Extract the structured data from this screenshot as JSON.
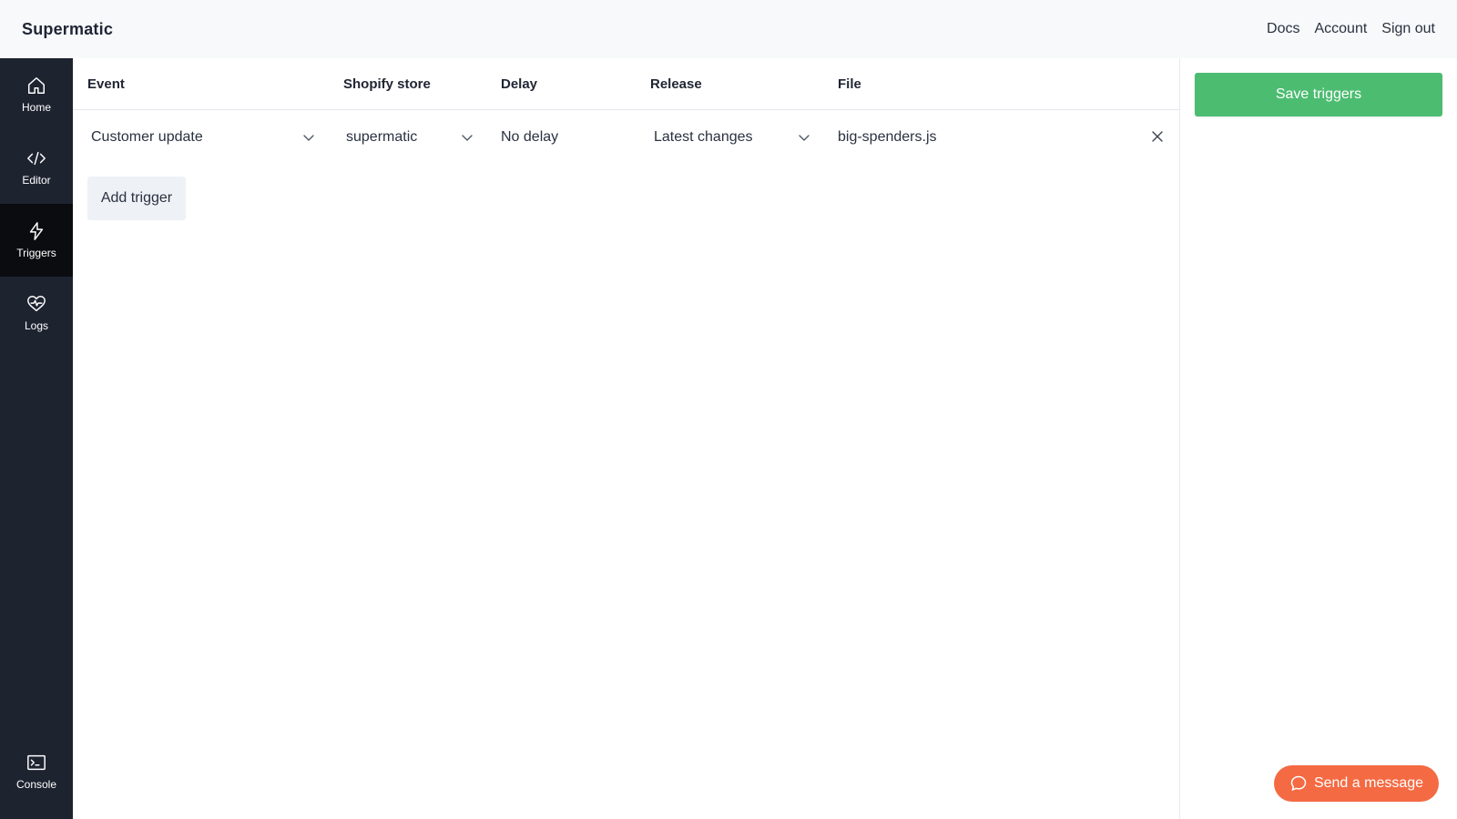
{
  "app": {
    "brand": "Supermatic"
  },
  "topnav": {
    "docs": "Docs",
    "account": "Account",
    "signout": "Sign out"
  },
  "sidebar": {
    "items": [
      {
        "label": "Home",
        "icon": "home-icon"
      },
      {
        "label": "Editor",
        "icon": "code-icon"
      },
      {
        "label": "Triggers",
        "icon": "lightning-icon",
        "active": true
      },
      {
        "label": "Logs",
        "icon": "heart-pulse-icon"
      }
    ],
    "console": {
      "label": "Console",
      "icon": "terminal-icon"
    }
  },
  "table": {
    "headers": {
      "event": "Event",
      "store": "Shopify store",
      "delay": "Delay",
      "release": "Release",
      "file": "File"
    },
    "rows": [
      {
        "event": "Customer update",
        "store": "supermatic",
        "delay": "No delay",
        "release": "Latest changes",
        "file": "big-spenders.js"
      }
    ]
  },
  "actions": {
    "add_trigger": "Add trigger",
    "save_triggers": "Save triggers"
  },
  "chat": {
    "label": "Send a message"
  },
  "colors": {
    "sidebar": "#1e2330",
    "sidebar_active": "#0b0c0f",
    "save": "#4cbc71",
    "chat": "#f46a43",
    "topbar": "#f7f9fb"
  }
}
